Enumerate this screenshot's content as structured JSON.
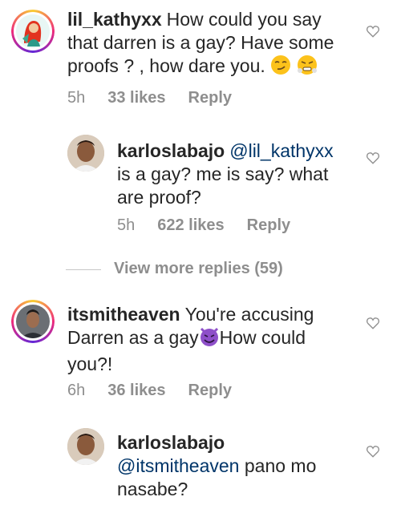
{
  "comments": [
    {
      "username": "lil_kathyxx",
      "text": "How could you say that darren is a gay? Have some proofs ? , how dare you.",
      "time": "5h",
      "likes": "33 likes",
      "reply": "Reply",
      "avatar": "cartoon-girl-avatar",
      "emojis": [
        "smirking-face-emoji",
        "face-with-steam-emoji"
      ]
    },
    {
      "username": "karloslabajo",
      "mention": "@lil_kathyxx",
      "text": "is a gay? me is say? what are proof?",
      "time": "5h",
      "likes": "622 likes",
      "reply": "Reply",
      "avatar": "man-portrait-avatar"
    },
    {
      "username": "itsmitheaven",
      "text_before": "You're accusing Darren as a gay",
      "text_after": "How could you?!",
      "time": "6h",
      "likes": "36 likes",
      "reply": "Reply",
      "avatar": "man-portrait-avatar",
      "emojis": [
        "smiling-imp-emoji"
      ]
    },
    {
      "username": "karloslabajo",
      "mention": "@itsmitheaven",
      "text": "pano mo nasabe?",
      "avatar": "man-portrait-avatar"
    }
  ],
  "view_more": "View more replies (59)",
  "colors": {
    "text": "#262626",
    "meta": "#8e8e8e",
    "mention": "#003569",
    "purple_emoji": "#8e4fc9"
  },
  "icons": [
    "heart-outline-icon"
  ]
}
